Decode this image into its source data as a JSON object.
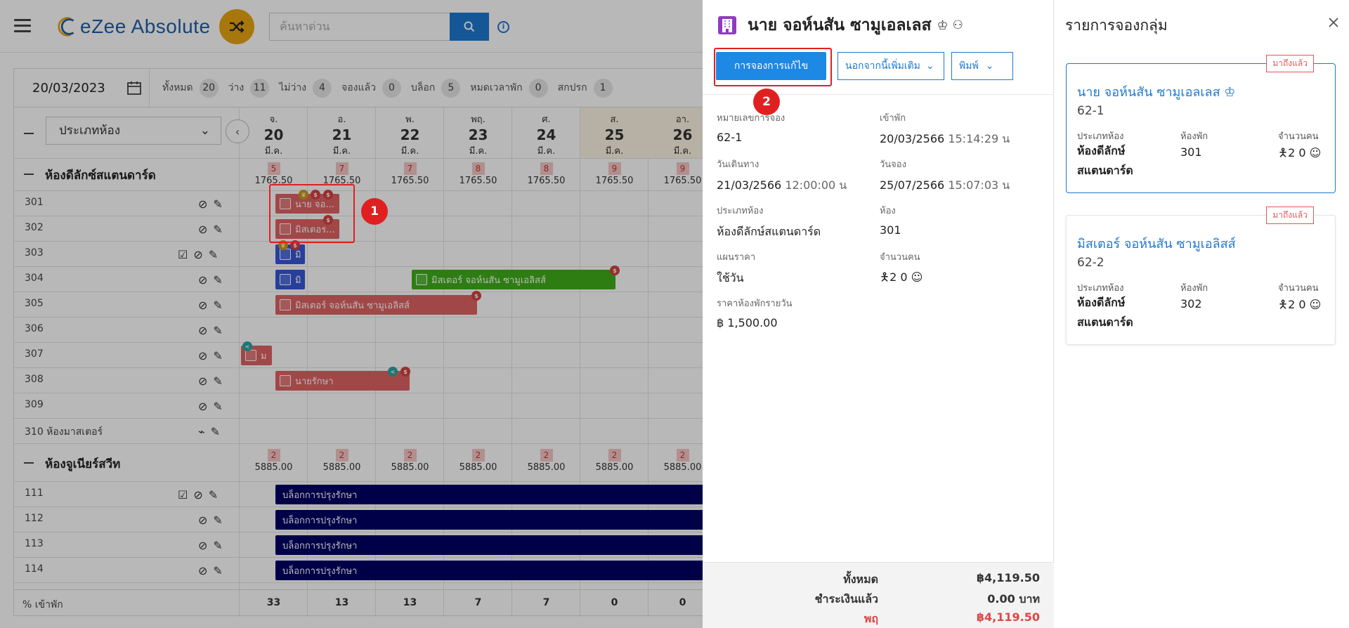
{
  "header": {
    "logo_text": "eZee Absolute",
    "search_placeholder": "ค้นหาด่วน"
  },
  "calendar": {
    "date": "20/03/2023",
    "stats": [
      {
        "label": "ทั้งหมด",
        "value": "20"
      },
      {
        "label": "ว่าง",
        "value": "11"
      },
      {
        "label": "ไม่ว่าง",
        "value": "4"
      },
      {
        "label": "จองแล้ว",
        "value": "0"
      },
      {
        "label": "บล็อก",
        "value": "5"
      },
      {
        "label": "หมดเวลาพัก",
        "value": "0"
      },
      {
        "label": "สกปรก",
        "value": "1"
      }
    ],
    "room_type_select": "ประเภทห้อง",
    "days": [
      {
        "dow": "จ.",
        "day": "20",
        "mon": "มี.ค."
      },
      {
        "dow": "อ.",
        "day": "21",
        "mon": "มี.ค."
      },
      {
        "dow": "พ.",
        "day": "22",
        "mon": "มี.ค."
      },
      {
        "dow": "พฤ.",
        "day": "23",
        "mon": "มี.ค."
      },
      {
        "dow": "ศ.",
        "day": "24",
        "mon": "มี.ค."
      },
      {
        "dow": "ส.",
        "day": "25",
        "mon": "มี.ค."
      },
      {
        "dow": "อา.",
        "day": "26",
        "mon": "มี.ค."
      }
    ],
    "groups": [
      {
        "title": "ห้องดีลักซ์สแตนดาร์ด",
        "counts": [
          "5",
          "7",
          "7",
          "8",
          "8",
          "9",
          "9"
        ],
        "rate": "1765.50",
        "rooms": [
          "301",
          "302",
          "303",
          "304",
          "305",
          "306",
          "307",
          "308",
          "309",
          "310 ห้องมาสเตอร์"
        ]
      },
      {
        "title": "ห้องจูเนียร์สวีท",
        "counts": [
          "2",
          "2",
          "2",
          "2",
          "2",
          "2",
          "2"
        ],
        "rate": "5885.00",
        "rooms": [
          "111",
          "112",
          "113",
          "114"
        ]
      }
    ],
    "bookings": {
      "b301": "นาย จอ...",
      "b302": "มิสเตอร...",
      "b303": "มิ",
      "b304a": "มิ",
      "b304b": "มิสเตอร์ จอห์นสัน ซามูเอลิสส์",
      "b305": "มิสเตอร์ จอห์นสัน ซามูเอลิสส์",
      "b307": "ม",
      "b308": "นายรักษา",
      "block": "บล็อกการปรุงรักษา"
    },
    "occupancy_label": "% เข้าพัก",
    "occupancy": [
      "33",
      "13",
      "13",
      "7",
      "7",
      "0",
      "0"
    ]
  },
  "annotations": {
    "m1": "1",
    "m2": "2"
  },
  "detail": {
    "guest_name": "นาย จอห์นสัน ซามูเอลเลส",
    "btn_edit": "การจองการแก้ไข",
    "btn_more": "นอกจากนี้เพิ่มเติม",
    "btn_print": "พิมพ์",
    "reservation_no_label": "หมายเลขการจอง",
    "reservation_no": "62-1",
    "checkin_label": "เข้าพัก",
    "checkin_date": "20/03/2566",
    "checkin_time": "15:14:29 น",
    "departure_label": "วันเดินทาง",
    "departure_date": "21/03/2566",
    "departure_time": "12:00:00 น",
    "booking_label": "วันจอง",
    "booking_date": "25/07/2566",
    "booking_time": "15:07:03 น",
    "room_type_label": "ประเภทห้อง",
    "room_type": "ห้องดีลักษ์สแตนดาร์ด",
    "room_label": "ห้อง",
    "room": "301",
    "rate_plan_label": "แผนราคา",
    "rate_plan": "ใช้วัน",
    "pax_label": "จำนวนคน",
    "pax": "2 0",
    "daily_rate_label": "ราคาห้องพักรายวัน",
    "daily_rate": "฿ 1,500.00",
    "total_label": "ทั้งหมด",
    "total": "฿4,119.50",
    "paid_label": "ชำระเงินแล้ว",
    "paid": "0.00 บาท",
    "balance_label": "พฤ",
    "balance": "฿4,119.50"
  },
  "group": {
    "title": "รายการจองกลุ่ม",
    "cards": [
      {
        "badge": "มาถึงแล้ว",
        "name": "นาย จอห์นสัน ซามูเอลเลส",
        "res": "62-1",
        "room_type_label": "ประเภทห้อง",
        "room_type": "ห้องดีลักษ์ สแตนดาร์ด",
        "room_label": "ห้องพัก",
        "room": "301",
        "pax_label": "จำนวนคน",
        "pax": "2 0"
      },
      {
        "badge": "มาถึงแล้ว",
        "name": "มิสเตอร์ จอห์นสัน ซามูเอลิสส์",
        "res": "62-2",
        "room_type_label": "ประเภทห้อง",
        "room_type": "ห้องดีลักษ์ สแตนดาร์ด",
        "room_label": "ห้องพัก",
        "room": "302",
        "pax_label": "จำนวนคน",
        "pax": "2 0"
      }
    ]
  },
  "colors": {
    "accent": "#1e88e5",
    "booking_red": "#e06363",
    "booking_blue": "#3656d6",
    "booking_green": "#3fae1a",
    "block_navy": "#000066",
    "annotation_red": "#e02020"
  }
}
